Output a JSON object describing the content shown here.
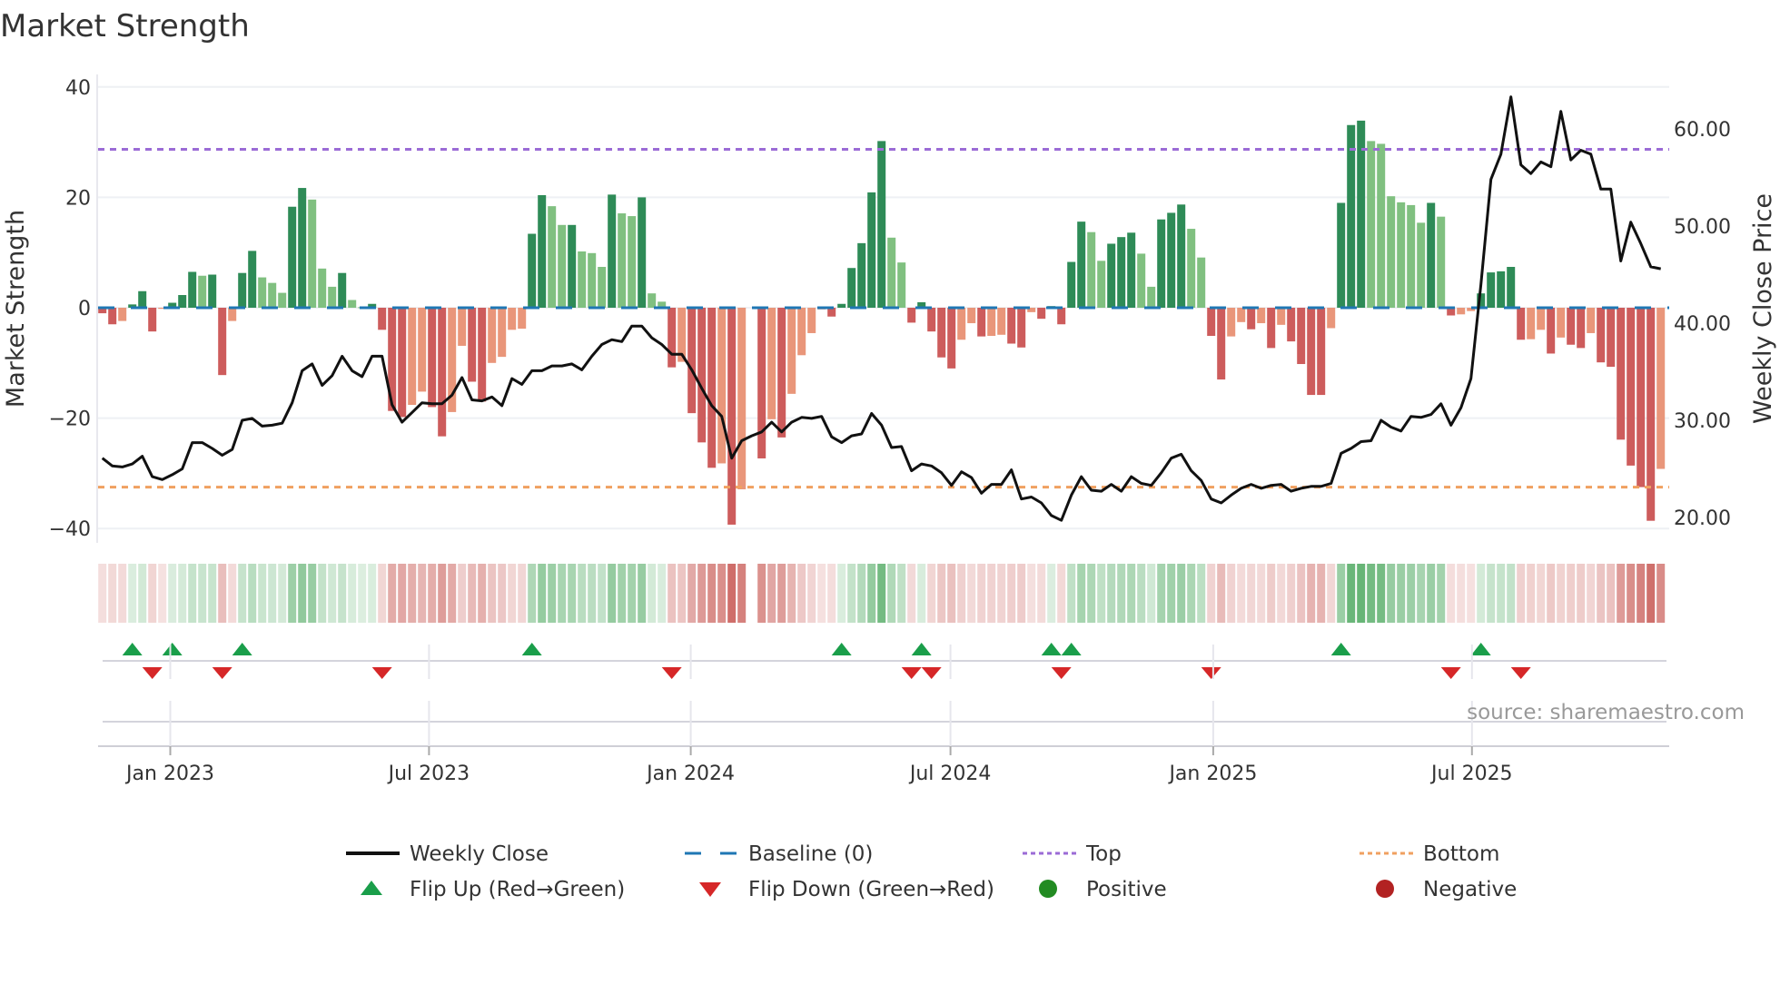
{
  "title": "Market Strength",
  "source": "source: sharemaestro.com",
  "colors": {
    "pos_rising": "#2e8b57",
    "pos_falling": "#80c080",
    "neg_falling": "#cd5c5c",
    "neg_rising": "#e9967a",
    "baseline": "#1f77b4",
    "top": "#9b6bd6",
    "bottom": "#f0a060",
    "flip_up": "#1a9e4a",
    "flip_down": "#d62728",
    "positive": "#228b22",
    "negative": "#b22222",
    "price": "#111111"
  },
  "chart_data": {
    "type": "bar",
    "title": "Market Strength",
    "ylabel": "Market Strength",
    "y2label": "Weekly Close Price",
    "ylim": [
      -40,
      40
    ],
    "y2lim": [
      20,
      60
    ],
    "yticks": [
      "40",
      "20",
      "0",
      "−20",
      "−40"
    ],
    "ytick_values": [
      40,
      20,
      0,
      -20,
      -40
    ],
    "y2ticks": [
      "60.00",
      "50.00",
      "40.00",
      "30.00",
      "20.00"
    ],
    "y2tick_values": [
      60,
      50,
      40,
      30,
      20
    ],
    "x_ticks": [
      {
        "label": "Jan 2023",
        "week": 7.8
      },
      {
        "label": "Jul 2023",
        "week": 33.7
      },
      {
        "label": "Jan 2024",
        "week": 59.9
      },
      {
        "label": "Jul 2024",
        "week": 85.9
      },
      {
        "label": "Jan 2025",
        "week": 112.2
      },
      {
        "label": "Jul 2025",
        "week": 138.1
      }
    ],
    "top": 28.7,
    "bottom": -32.5,
    "baseline": 0,
    "strength": [
      -1,
      -3,
      -2.4,
      0.6,
      3,
      -4.3,
      -0.2,
      0.9,
      2.3,
      6.5,
      5.8,
      6,
      -12.2,
      -2.4,
      6.3,
      10.3,
      5.5,
      4.5,
      2.7,
      18.3,
      21.7,
      19.6,
      7.1,
      3.8,
      6.3,
      1.4,
      0.1,
      0.7,
      -4,
      -18.7,
      -19.8,
      -17.6,
      -15.2,
      -18,
      -23.3,
      -18.9,
      -6.9,
      -13.4,
      -17,
      -10,
      -8.9,
      -4,
      -3.8,
      13.4,
      20.4,
      18.4,
      15,
      15,
      10.2,
      9.9,
      7.4,
      20.5,
      17.1,
      16.6,
      20,
      2.6,
      1.1,
      -10.8,
      -9.8,
      -19.1,
      -24.4,
      -29,
      -28.2,
      -39.3,
      -32.9,
      null,
      -27.3,
      -20.2,
      -23.5,
      -15.6,
      -8.6,
      -4.6,
      -0.3,
      -1.6,
      0.7,
      7.2,
      11.7,
      20.9,
      30.2,
      12.7,
      8.2,
      -2.7,
      1,
      -4.3,
      -9,
      -11,
      -5.8,
      -2.8,
      -5.2,
      -5.1,
      -4.9,
      -6.5,
      -7.2,
      -0.8,
      -2,
      0.3,
      -3,
      8.3,
      15.6,
      13.7,
      8.5,
      11.6,
      12.8,
      13.6,
      9.8,
      3.8,
      16,
      17.2,
      18.7,
      14.3,
      9.1,
      -5.1,
      -13,
      -5.2,
      -2.6,
      -3.9,
      -2.8,
      -7.3,
      -3.1,
      -6.1,
      -10.2,
      -15.8,
      -15.8,
      -3.7,
      19,
      33.1,
      33.9,
      30.2,
      29.7,
      20.2,
      19.1,
      18.6,
      15.4,
      19,
      16.5,
      -1.4,
      -1.2,
      -0.6,
      2.6,
      6.4,
      6.6,
      7.4,
      -5.8,
      -5.7,
      -4,
      -8.3,
      -5.4,
      -6.7,
      -7.3,
      -4.6,
      -9.9,
      -10.7,
      -23.9,
      -28.6,
      -32.5,
      -38.6,
      -29.2
    ],
    "weekly_close": [
      26.1,
      25.3,
      25.2,
      25.5,
      26.3,
      24.2,
      23.9,
      24.4,
      25.0,
      27.7,
      27.7,
      27.1,
      26.4,
      27.0,
      30.0,
      30.2,
      29.4,
      29.5,
      29.7,
      31.8,
      35.1,
      35.8,
      33.6,
      34.6,
      36.6,
      35.1,
      34.5,
      36.6,
      36.6,
      31.6,
      29.8,
      30.8,
      31.8,
      31.7,
      31.7,
      32.6,
      34.4,
      32.1,
      32.0,
      32.4,
      31.5,
      34.3,
      33.7,
      35.1,
      35.1,
      35.6,
      35.6,
      35.8,
      35.2,
      36.6,
      37.8,
      38.3,
      38.1,
      39.7,
      39.7,
      38.5,
      37.8,
      36.8,
      36.8,
      35.2,
      33.3,
      31.5,
      30.4,
      26.1,
      27.9,
      28.4,
      28.8,
      29.8,
      28.8,
      29.8,
      30.3,
      30.2,
      30.4,
      28.3,
      27.7,
      28.4,
      28.6,
      30.7,
      29.5,
      27.2,
      27.3,
      24.8,
      25.5,
      25.3,
      24.6,
      23.3,
      24.7,
      24.1,
      22.5,
      23.4,
      23.4,
      24.9,
      21.9,
      22.1,
      21.5,
      20.2,
      19.7,
      22.3,
      24.2,
      22.8,
      22.7,
      23.4,
      22.7,
      24.2,
      23.5,
      23.3,
      24.6,
      26.1,
      26.5,
      24.8,
      23.8,
      21.9,
      21.5,
      22.3,
      23.0,
      23.4,
      23.0,
      23.3,
      23.4,
      22.7,
      23.0,
      23.2,
      23.2,
      23.5,
      26.6,
      27.1,
      27.8,
      27.9,
      30.0,
      29.3,
      28.9,
      30.4,
      30.3,
      30.6,
      31.7,
      29.5,
      31.3,
      34.3,
      44.0,
      54.8,
      57.4,
      63.3,
      56.3,
      55.4,
      56.6,
      56.1,
      61.8,
      56.8,
      57.8,
      57.4,
      53.8,
      53.8,
      46.4,
      50.4,
      48.2,
      45.8,
      45.6
    ],
    "flip_up_weeks": [
      4,
      8,
      15,
      44,
      75,
      83,
      96,
      98,
      125,
      139
    ],
    "flip_down_weeks": [
      6,
      13,
      29,
      58,
      82,
      84,
      97,
      112,
      136,
      143
    ],
    "legend": [
      {
        "label": "Weekly Close",
        "symbol": "line"
      },
      {
        "label": "Baseline (0)",
        "symbol": "dash"
      },
      {
        "label": "Top",
        "symbol": "dot-purple"
      },
      {
        "label": "Bottom",
        "symbol": "dot-orange"
      },
      {
        "label": "Flip Up (Red→Green)",
        "symbol": "triangle-up"
      },
      {
        "label": "Flip Down (Green→Red)",
        "symbol": "triangle-down"
      },
      {
        "label": "Positive",
        "symbol": "circle-green"
      },
      {
        "label": "Negative",
        "symbol": "circle-red"
      }
    ],
    "legend_position": "bottom"
  }
}
